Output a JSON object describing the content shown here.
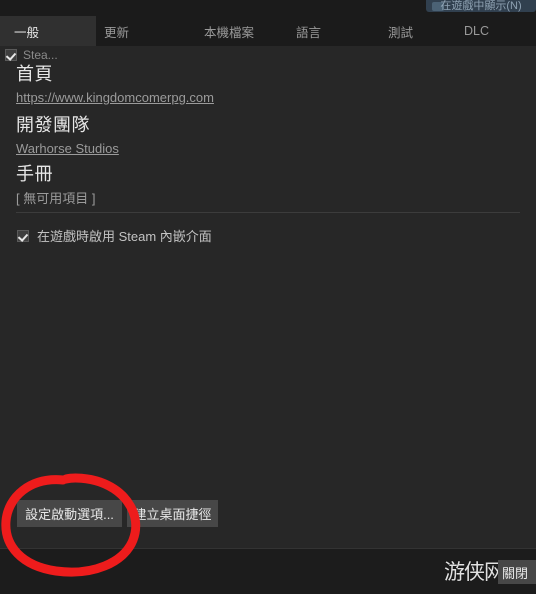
{
  "window": {
    "top_widget_label": "在遊戲中顯示(N)"
  },
  "tabs": [
    {
      "label": "一般",
      "active": true
    },
    {
      "label": "更新",
      "active": false
    },
    {
      "label": "本機檔案",
      "active": false
    },
    {
      "label": "語言",
      "active": false
    },
    {
      "label": "測試",
      "active": false
    },
    {
      "label": "DLC",
      "active": false
    }
  ],
  "content": {
    "truncated_checkbox_label": "Stea...",
    "sections": [
      {
        "heading": "首頁",
        "link": "https://www.kingdomcomerpg.com"
      },
      {
        "heading": "開發團隊",
        "link": "Warhorse Studios"
      },
      {
        "heading": "手冊",
        "link": "[ 無可用項目 ]"
      }
    ],
    "overlay_checkbox_label": "在遊戲時啟用 Steam 內嵌介面"
  },
  "buttons": {
    "launch_options": "設定啟動選項...",
    "desktop_shortcut": "建立桌面捷徑"
  },
  "footer": {
    "close_button": "關閉",
    "watermark": "游侠网"
  },
  "colors": {
    "background": "#272727",
    "tabbar": "#1b1b1b",
    "active_tab": "#303030",
    "button": "#474747",
    "annotation_red": "#ee1c1c",
    "link": "#9b9b9b"
  }
}
